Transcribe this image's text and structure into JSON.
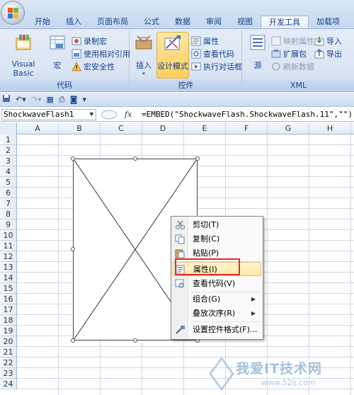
{
  "tabs": [
    "开始",
    "插入",
    "页面布局",
    "公式",
    "数据",
    "审阅",
    "视图",
    "开发工具",
    "加载项"
  ],
  "active_tab": "开发工具",
  "ribbon": {
    "code": {
      "label": "代码",
      "visual_basic": "Visual Basic",
      "macros": "宏",
      "record_macro": "录制宏",
      "relative_refs": "使用相对引用",
      "macro_security": "宏安全性"
    },
    "controls": {
      "label": "控件",
      "insert": "插入",
      "design_mode": "设计模式",
      "properties": "属性",
      "view_code": "查看代码",
      "run_dialog": "执行对话框"
    },
    "xml": {
      "label": "XML",
      "source": "源",
      "map_properties": "映射属性",
      "expansion_packs": "扩展包",
      "refresh_data": "刷新数据",
      "import": "导入",
      "export": "导出"
    }
  },
  "formula_bar": {
    "name_box": "ShockwaveFlash1",
    "fx_label": "fx",
    "formula": "=EMBED(\"ShockwaveFlash.ShockwaveFlash.11\",\"\")"
  },
  "columns": [
    "A",
    "B",
    "C",
    "D",
    "E",
    "F",
    "G",
    "H"
  ],
  "rows": [
    "1",
    "2",
    "3",
    "4",
    "5",
    "6",
    "7",
    "8",
    "9",
    "10",
    "11",
    "12",
    "13",
    "14",
    "15",
    "16",
    "17",
    "18",
    "19",
    "20",
    "21",
    "22",
    "23",
    "24"
  ],
  "context_menu": {
    "cut": "剪切(T)",
    "copy": "复制(C)",
    "paste": "粘贴(P)",
    "properties": "属性(I)",
    "view_code": "查看代码(V)",
    "group": "组合(G)",
    "order": "叠放次序(R)",
    "format_control": "设置控件格式(F)..."
  },
  "colors": {
    "ribbon_text": "#15428b",
    "highlight_button": "#fbcf5c",
    "annotation_red": "#d9302a"
  },
  "watermark": {
    "text": "我爱IT技术网",
    "url": "www.52ij.com"
  }
}
